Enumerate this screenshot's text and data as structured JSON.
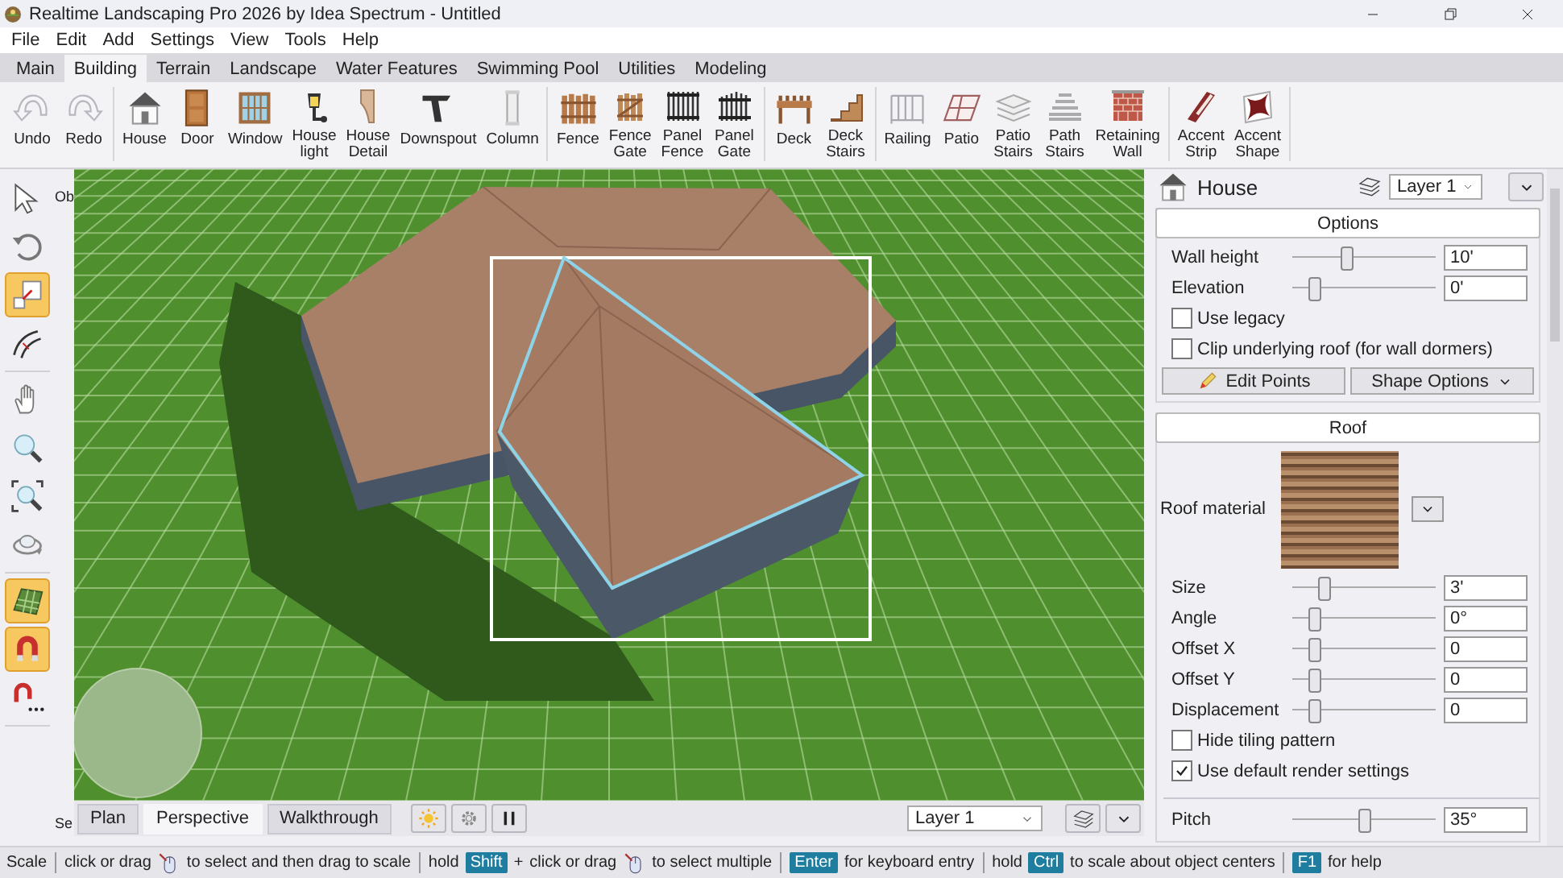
{
  "window": {
    "title": "Realtime Landscaping Pro 2026 by Idea Spectrum - Untitled"
  },
  "menu": [
    "File",
    "Edit",
    "Add",
    "Settings",
    "View",
    "Tools",
    "Help"
  ],
  "tabs": [
    {
      "label": "Main",
      "selected": false
    },
    {
      "label": "Building",
      "selected": true
    },
    {
      "label": "Terrain",
      "selected": false
    },
    {
      "label": "Landscape",
      "selected": false
    },
    {
      "label": "Water Features",
      "selected": false
    },
    {
      "label": "Swimming Pool",
      "selected": false
    },
    {
      "label": "Utilities",
      "selected": false
    },
    {
      "label": "Modeling",
      "selected": false
    }
  ],
  "ribbon": {
    "groups": [
      [
        "Undo",
        "Redo"
      ],
      [
        "House",
        "Door",
        "Window",
        "House light",
        "House Detail",
        "Downspout",
        "Column"
      ],
      [
        "Fence",
        "Fence Gate",
        "Panel Fence",
        "Panel Gate"
      ],
      [
        "Deck",
        "Deck Stairs"
      ],
      [
        "Railing",
        "Patio",
        "Patio Stairs",
        "Path Stairs",
        "Retaining Wall"
      ],
      [
        "Accent Strip",
        "Accent Shape"
      ]
    ]
  },
  "tools": {
    "groups": [
      [
        {
          "selected": false
        },
        {
          "selected": false
        },
        {
          "selected": true
        },
        {
          "selected": false
        }
      ],
      [
        {
          "selected": false
        },
        {
          "selected": false
        },
        {
          "selected": false
        },
        {
          "selected": false
        }
      ],
      [
        {
          "selected": true
        },
        {
          "selected": true
        },
        {
          "selected": false
        }
      ]
    ]
  },
  "viewport": {
    "side_labels": [
      "Ob",
      "Se"
    ],
    "view_tabs": [
      {
        "label": "Plan",
        "selected": false
      },
      {
        "label": "Perspective",
        "selected": true
      },
      {
        "label": "Walkthrough",
        "selected": false
      }
    ],
    "layer_select": "Layer 1"
  },
  "panel": {
    "title": "House",
    "layer_select": "Layer 1",
    "sections": [
      {
        "title": "Options",
        "rows": [
          {
            "kind": "slider",
            "label": "Wall height",
            "level": 0.38,
            "value": "10'"
          },
          {
            "kind": "slider",
            "label": "Elevation",
            "level": 0.16,
            "value": "0'"
          },
          {
            "kind": "checkbox",
            "label": "Use legacy",
            "checked": false
          },
          {
            "kind": "checkbox",
            "label": "Clip underlying roof (for wall dormers)",
            "checked": false
          },
          {
            "kind": "buttons",
            "buttons": [
              "Edit Points",
              "Shape Options"
            ]
          }
        ]
      },
      {
        "title": "Roof",
        "rows": [
          {
            "kind": "material",
            "label": "Roof material"
          },
          {
            "kind": "slider",
            "label": "Size",
            "level": 0.22,
            "value": "3'"
          },
          {
            "kind": "slider",
            "label": "Angle",
            "level": 0.16,
            "value": "0°"
          },
          {
            "kind": "slider",
            "label": "Offset X",
            "level": 0.16,
            "value": "0"
          },
          {
            "kind": "slider",
            "label": "Offset Y",
            "level": 0.16,
            "value": "0"
          },
          {
            "kind": "slider",
            "label": "Displacement",
            "level": 0.16,
            "value": "0"
          },
          {
            "kind": "checkbox",
            "label": "Hide tiling pattern",
            "checked": false
          },
          {
            "kind": "checkbox",
            "label": "Use default render settings",
            "checked": true
          },
          {
            "kind": "divider"
          },
          {
            "kind": "slider",
            "label": "Pitch",
            "level": 0.5,
            "value": "35°"
          }
        ]
      }
    ]
  },
  "status_bar": [
    {
      "kind": "text",
      "text": "Scale"
    },
    {
      "kind": "separator"
    },
    {
      "kind": "text",
      "text": "click or drag"
    },
    {
      "kind": "mouse"
    },
    {
      "kind": "text",
      "text": "to select and then drag to scale"
    },
    {
      "kind": "separator"
    },
    {
      "kind": "text",
      "text": "hold"
    },
    {
      "kind": "key",
      "text": "Shift"
    },
    {
      "kind": "text",
      "text": "+"
    },
    {
      "kind": "text",
      "text": "click or drag"
    },
    {
      "kind": "mouse"
    },
    {
      "kind": "text",
      "text": "to select multiple"
    },
    {
      "kind": "separator"
    },
    {
      "kind": "key",
      "text": "Enter"
    },
    {
      "kind": "text",
      "text": "for keyboard entry"
    },
    {
      "kind": "separator"
    },
    {
      "kind": "text",
      "text": "hold"
    },
    {
      "kind": "key",
      "text": "Ctrl"
    },
    {
      "kind": "text",
      "text": "to scale about object centers"
    },
    {
      "kind": "separator"
    },
    {
      "kind": "key",
      "text": "F1"
    },
    {
      "kind": "text",
      "text": "for help"
    }
  ]
}
